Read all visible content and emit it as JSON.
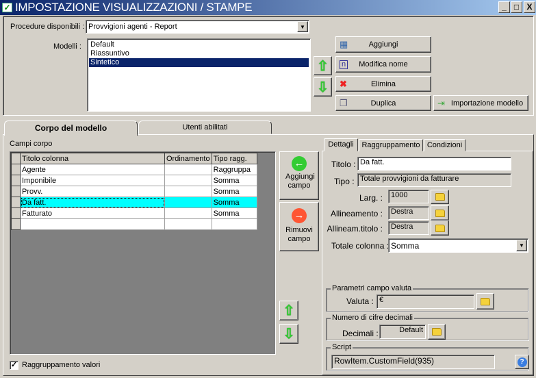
{
  "window": {
    "title": "IMPOSTAZIONE VISUALIZZAZIONI / STAMPE",
    "minimize": "_",
    "maximize": "□",
    "close": "X"
  },
  "procedure": {
    "label": "Procedure disponibili :",
    "value": "Provvigioni agenti - Report"
  },
  "modelli": {
    "label": "Modelli :",
    "items": [
      "Default",
      "Riassuntivo",
      "Sintetico"
    ],
    "selected": "Sintetico"
  },
  "actions": {
    "add": "Aggiungi",
    "rename": "Modifica nome",
    "delete": "Elimina",
    "duplicate": "Duplica",
    "import": "Importazione modello"
  },
  "tabs": {
    "body": "Corpo del modello",
    "users": "Utenti abilitati"
  },
  "campi": {
    "label": "Campi corpo",
    "columns": [
      "Titolo colonna",
      "Ordinamento",
      "Tipo ragg."
    ],
    "rows": [
      [
        "Agente",
        "",
        "Raggruppa"
      ],
      [
        "Imponibile",
        "",
        "Somma"
      ],
      [
        "Provv.",
        "",
        "Somma"
      ],
      [
        "Da fatt.",
        "",
        "Somma"
      ],
      [
        "Fatturato",
        "",
        "Somma"
      ],
      [
        "",
        "",
        ""
      ]
    ],
    "current_row": 3,
    "selection_color": "#00ffff"
  },
  "field_buttons": {
    "add": "Aggiungi campo",
    "remove": "Rimuovi campo"
  },
  "grouping_checkbox": {
    "label": "Raggruppamento valori",
    "checked": true
  },
  "detail_tabs": [
    "Dettagli",
    "Raggruppamento",
    "Condizioni"
  ],
  "details": {
    "titolo_label": "Titolo :",
    "titolo": "Da fatt.",
    "tipo_label": "Tipo :",
    "tipo": "Totale provvigioni da fatturare",
    "larg_label": "Larg. :",
    "larg": "1000",
    "allineamento_label": "Allineamento :",
    "allineamento": "Destra",
    "allineam_titolo_label": "Allineam.titolo :",
    "allineam_titolo": "Destra",
    "totale_label": "Totale colonna :",
    "totale": "Somma",
    "valuta_group": "Parametri campo valuta",
    "valuta_label": "Valuta :",
    "valuta": "€",
    "decimali_group": "Numero di cifre decimali",
    "decimali_label": "Decimali :",
    "decimali": "Default",
    "script_group": "Script",
    "script": "RowItem.CustomField(935)"
  }
}
